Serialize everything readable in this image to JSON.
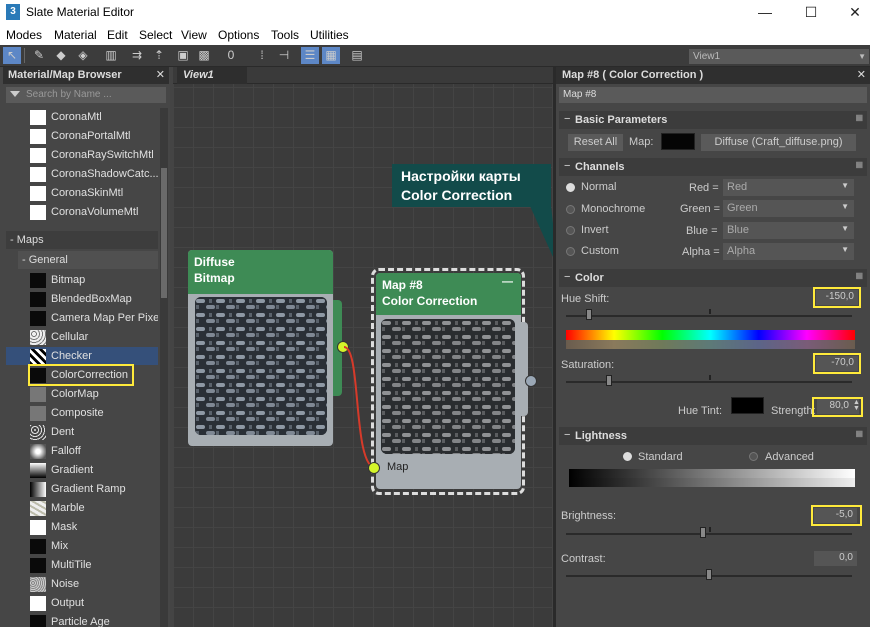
{
  "window": {
    "app_icon": "3",
    "title": "Slate Material Editor",
    "minimize": "—",
    "maximize": "☐",
    "close": "✕"
  },
  "menu": [
    "Modes",
    "Material",
    "Edit",
    "Select",
    "View",
    "Options",
    "Tools",
    "Utilities"
  ],
  "toolbar": {
    "view_select": "View1"
  },
  "browser": {
    "title": "Material/Map Browser",
    "search_placeholder": "Search by Name ...",
    "top_items": [
      "CoronaMtl",
      "CoronaPortalMtl",
      "CoronaRaySwitchMtl",
      "CoronaShadowCatc...",
      "CoronaSkinMtl",
      "CoronaVolumeMtl"
    ],
    "maps_group": "- Maps",
    "general_group": "- General",
    "map_items": [
      "Bitmap",
      "BlendedBoxMap",
      "Camera Map Per Pixel",
      "Cellular",
      "Checker",
      "ColorCorrection",
      "ColorMap",
      "Composite",
      "Dent",
      "Falloff",
      "Gradient",
      "Gradient Ramp",
      "Marble",
      "Mask",
      "Mix",
      "MultiTile",
      "Noise",
      "Output",
      "Particle Age"
    ],
    "selected_item": "Checker",
    "highlighted_item": "ColorCorrection"
  },
  "view": {
    "tab": "View1",
    "node_diffuse": {
      "line1": "Diffuse",
      "line2": "Bitmap"
    },
    "node_map": {
      "line1": "Map #8",
      "line2": "Color Correction",
      "port_label": "Map",
      "minimize": "—"
    },
    "callout": {
      "line1": "Настройки карты",
      "line2": "Color Correction"
    }
  },
  "editor": {
    "title": "Map #8  ( Color Correction )",
    "name_value": "Map #8",
    "basic": {
      "title": "Basic Parameters",
      "reset_all": "Reset All",
      "map_label": "Map:",
      "map_button": "Diffuse (Craft_diffuse.png)",
      "swatch_color": "#050505"
    },
    "channels": {
      "title": "Channels",
      "modes": [
        "Normal",
        "Monochrome",
        "Invert",
        "Custom"
      ],
      "selected_mode": "Normal",
      "rows": [
        {
          "label": "Red =",
          "value": "Red"
        },
        {
          "label": "Green =",
          "value": "Green"
        },
        {
          "label": "Blue =",
          "value": "Blue"
        },
        {
          "label": "Alpha =",
          "value": "Alpha"
        }
      ]
    },
    "color": {
      "title": "Color",
      "hue_shift_label": "Hue Shift:",
      "hue_shift_value": "-150,0",
      "hue_shift_fraction": 0.08,
      "saturation_label": "Saturation:",
      "saturation_value": "-70,0",
      "saturation_fraction": 0.15,
      "hue_tint_label": "Hue Tint:",
      "strength_label": "Strength:",
      "strength_value": "80,0",
      "hue_tint_color": "#000000"
    },
    "lightness": {
      "title": "Lightness",
      "modes": [
        "Standard",
        "Advanced"
      ],
      "selected_mode": "Standard",
      "brightness_label": "Brightness:",
      "brightness_value": "-5,0",
      "brightness_fraction": 0.48,
      "contrast_label": "Contrast:",
      "contrast_value": "0,0",
      "contrast_fraction": 0.5
    }
  },
  "colors": {
    "highlight": "#ffea3b",
    "node_header": "#3e8b55",
    "selection": "#35507a",
    "callout": "#124b4a",
    "wire": "#d63a2a",
    "port_active": "#d4f52a"
  }
}
